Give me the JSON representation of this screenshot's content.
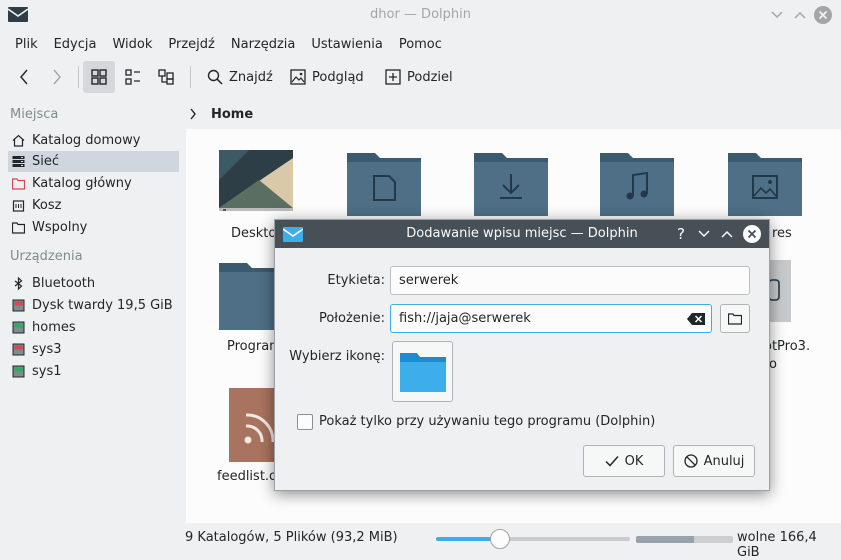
{
  "window": {
    "title": "dhor — Dolphin"
  },
  "menu": [
    "Plik",
    "Edycja",
    "Widok",
    "Przejdź",
    "Narzędzia",
    "Ustawienia",
    "Pomoc"
  ],
  "toolbar": {
    "find_label": "Znajdź",
    "preview_label": "Podgląd",
    "split_label": "Podziel"
  },
  "sidebar": {
    "places_header": "Miejsca",
    "places": [
      {
        "label": "Katalog domowy",
        "icon": "home-icon"
      },
      {
        "label": "Sieć",
        "icon": "network-icon"
      },
      {
        "label": "Katalog główny",
        "icon": "root-folder-icon"
      },
      {
        "label": "Kosz",
        "icon": "trash-icon"
      },
      {
        "label": "Wspolny",
        "icon": "folder-icon"
      }
    ],
    "devices_header": "Urządzenia",
    "devices": [
      {
        "label": "Bluetooth",
        "icon": "bluetooth-icon"
      },
      {
        "label": "Dysk twardy 19,5 GiB",
        "icon": "hard-drive-icon"
      },
      {
        "label": "homes",
        "icon": "drive-icon"
      },
      {
        "label": "sys3",
        "icon": "drive-icon"
      },
      {
        "label": "sys1",
        "icon": "drive-icon"
      }
    ]
  },
  "breadcrumb": {
    "current": "Home"
  },
  "files": [
    {
      "name": "Deskto",
      "icon": "desktop-thumbnail"
    },
    {
      "name": "",
      "icon": "documents-folder-icon"
    },
    {
      "name": "",
      "icon": "downloads-folder-icon"
    },
    {
      "name": "",
      "icon": "music-folder-icon"
    },
    {
      "name": "res",
      "icon": "pictures-folder-icon"
    },
    {
      "name": "Program",
      "icon": "folder-icon"
    },
    {
      "name": "otPro3.",
      "icon": "file-icon"
    },
    {
      "name": "o",
      "icon": ""
    },
    {
      "name": "feedlist.o",
      "icon": "rss-feed-icon"
    }
  ],
  "status": {
    "summary": "9 Katalogów, 5 Plików (93,2 MiB)",
    "free_space": "wolne 166,4 GiB",
    "zoom_level": 0.33,
    "disk_used_fraction": 0.6
  },
  "dialog": {
    "title": "Dodawanie wpisu miejsc — Dolphin",
    "label_field_label": "Etykieta:",
    "label_value": "serwerek",
    "location_label": "Położenie:",
    "location_value": "fish://jaja@serwerek",
    "icon_label": "Wybierz ikonę:",
    "checkbox_label": "Pokaż tylko przy używaniu tego programu (Dolphin)",
    "checkbox_checked": false,
    "ok_label": "OK",
    "cancel_label": "Anuluj"
  },
  "colors": {
    "accent": "#3daee9",
    "folder": "#4e6f85",
    "folder_tab": "#3a5a70",
    "dialog_title_bg": "#475057"
  }
}
